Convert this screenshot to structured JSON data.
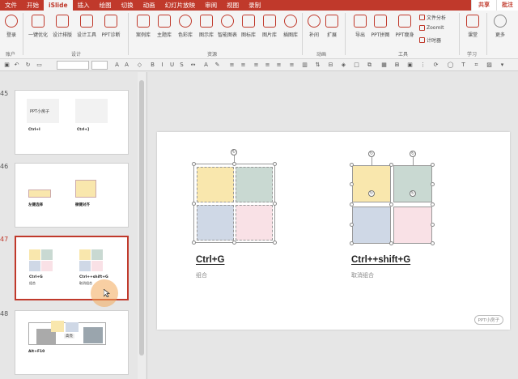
{
  "menu": {
    "tabs": [
      "文件",
      "开始",
      "iSlide",
      "插入",
      "绘图",
      "切换",
      "动画",
      "幻灯片放映",
      "审阅",
      "视图",
      "录制"
    ],
    "active_index": 2,
    "share": "共享",
    "comment": "批注"
  },
  "ribbon": {
    "account": {
      "login": "登录",
      "group": "账户"
    },
    "design": {
      "items": [
        "一键优化",
        "设计排版",
        "设计工具",
        "PPT诊断"
      ],
      "group": "设计"
    },
    "resources": {
      "items": [
        "案例库",
        "主题库",
        "色彩库",
        "图示库",
        "智能图表",
        "图标库",
        "图片库",
        "插图库"
      ],
      "group": "资源"
    },
    "animation": {
      "items": [
        "补间",
        "扩展"
      ],
      "group": "动画"
    },
    "tools": {
      "items": [
        "导出",
        "PPT拼图",
        "PPT瘦身"
      ],
      "small": [
        "文件分析",
        "ZoomIt",
        "计时器"
      ],
      "group": "工具"
    },
    "learning": {
      "items": [
        "课堂"
      ],
      "group": "学习"
    },
    "more": "更多"
  },
  "thumbnails": [
    {
      "number": "45",
      "texts": [
        "PPT小房子",
        "Ctrl+I",
        "Ctrl+]"
      ]
    },
    {
      "number": "46",
      "texts": [
        "左键选择",
        "微键对齐"
      ]
    },
    {
      "number": "47",
      "texts": [
        "Ctrl+G",
        "组合",
        "Ctrl++shift+G",
        "取消组合"
      ]
    },
    {
      "number": "48",
      "texts": [
        "Alt+F10",
        "高亮"
      ]
    }
  ],
  "slide": {
    "left_title": "Ctrl+G",
    "left_sub": "组合",
    "right_title": "Ctrl++shift+G",
    "right_sub": "取消组合",
    "brand": "PPT小房子"
  },
  "colors": {
    "accent": "#c0392b",
    "yellow": "#f9e7ad",
    "green": "#c9d9d2",
    "blue": "#cfd8e6",
    "pink": "#f9e1e6"
  }
}
